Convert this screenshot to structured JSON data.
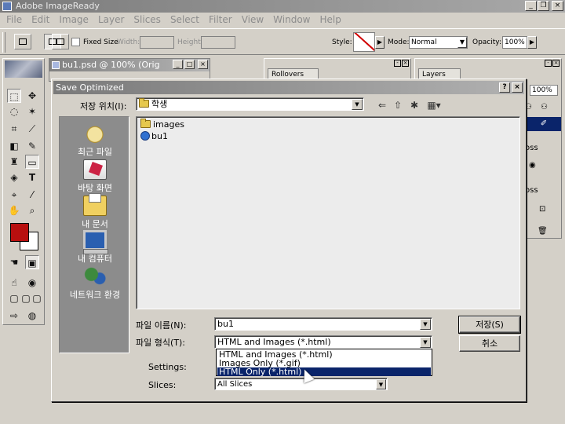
{
  "app": {
    "title": "Adobe ImageReady",
    "menus": [
      "File",
      "Edit",
      "Image",
      "Layer",
      "Slices",
      "Select",
      "Filter",
      "View",
      "Window",
      "Help"
    ]
  },
  "options_bar": {
    "fixed_size_label": "Fixed Size",
    "width_label": "Width:",
    "height_label": "Height:",
    "style_label": "Style:",
    "mode_label": "Mode:",
    "mode_value": "Normal",
    "opacity_label": "Opacity:",
    "opacity_value": "100%"
  },
  "background_doc": {
    "title": "bu1.psd @ 100% (Orig"
  },
  "panels": {
    "rollovers_tab": "Rollovers",
    "layers_tab": "Layers",
    "layers_opacity": "100%",
    "layer_rows": [
      "oss",
      "oss"
    ]
  },
  "dialog": {
    "title": "Save Optimized",
    "save_in_label": "저장 위치(I):",
    "save_in_value": "학생",
    "places": [
      {
        "label": "최근 파일",
        "icon": "recent-files-icon"
      },
      {
        "label": "바탕 화면",
        "icon": "desktop-icon"
      },
      {
        "label": "내 문서",
        "icon": "my-documents-icon"
      },
      {
        "label": "내 컴퓨터",
        "icon": "my-computer-icon"
      },
      {
        "label": "네트워크 환경",
        "icon": "network-icon"
      }
    ],
    "files": [
      {
        "name": "images",
        "icon": "folder-icon"
      },
      {
        "name": "bu1",
        "icon": "html-file-icon"
      }
    ],
    "filename_label": "파일 이름(N):",
    "filename_value": "bu1",
    "filetype_label": "파일 형식(T):",
    "filetype_value": "HTML and Images (*.html)",
    "filetype_options": [
      "HTML and Images (*.html)",
      "Images Only (*.gif)",
      "HTML Only (*.html)"
    ],
    "settings_label": "Settings:",
    "slices_label": "Slices:",
    "slices_value": "All Slices",
    "save_button": "저장(S)",
    "cancel_button": "취소",
    "help_button": "?",
    "close_button": "×"
  }
}
